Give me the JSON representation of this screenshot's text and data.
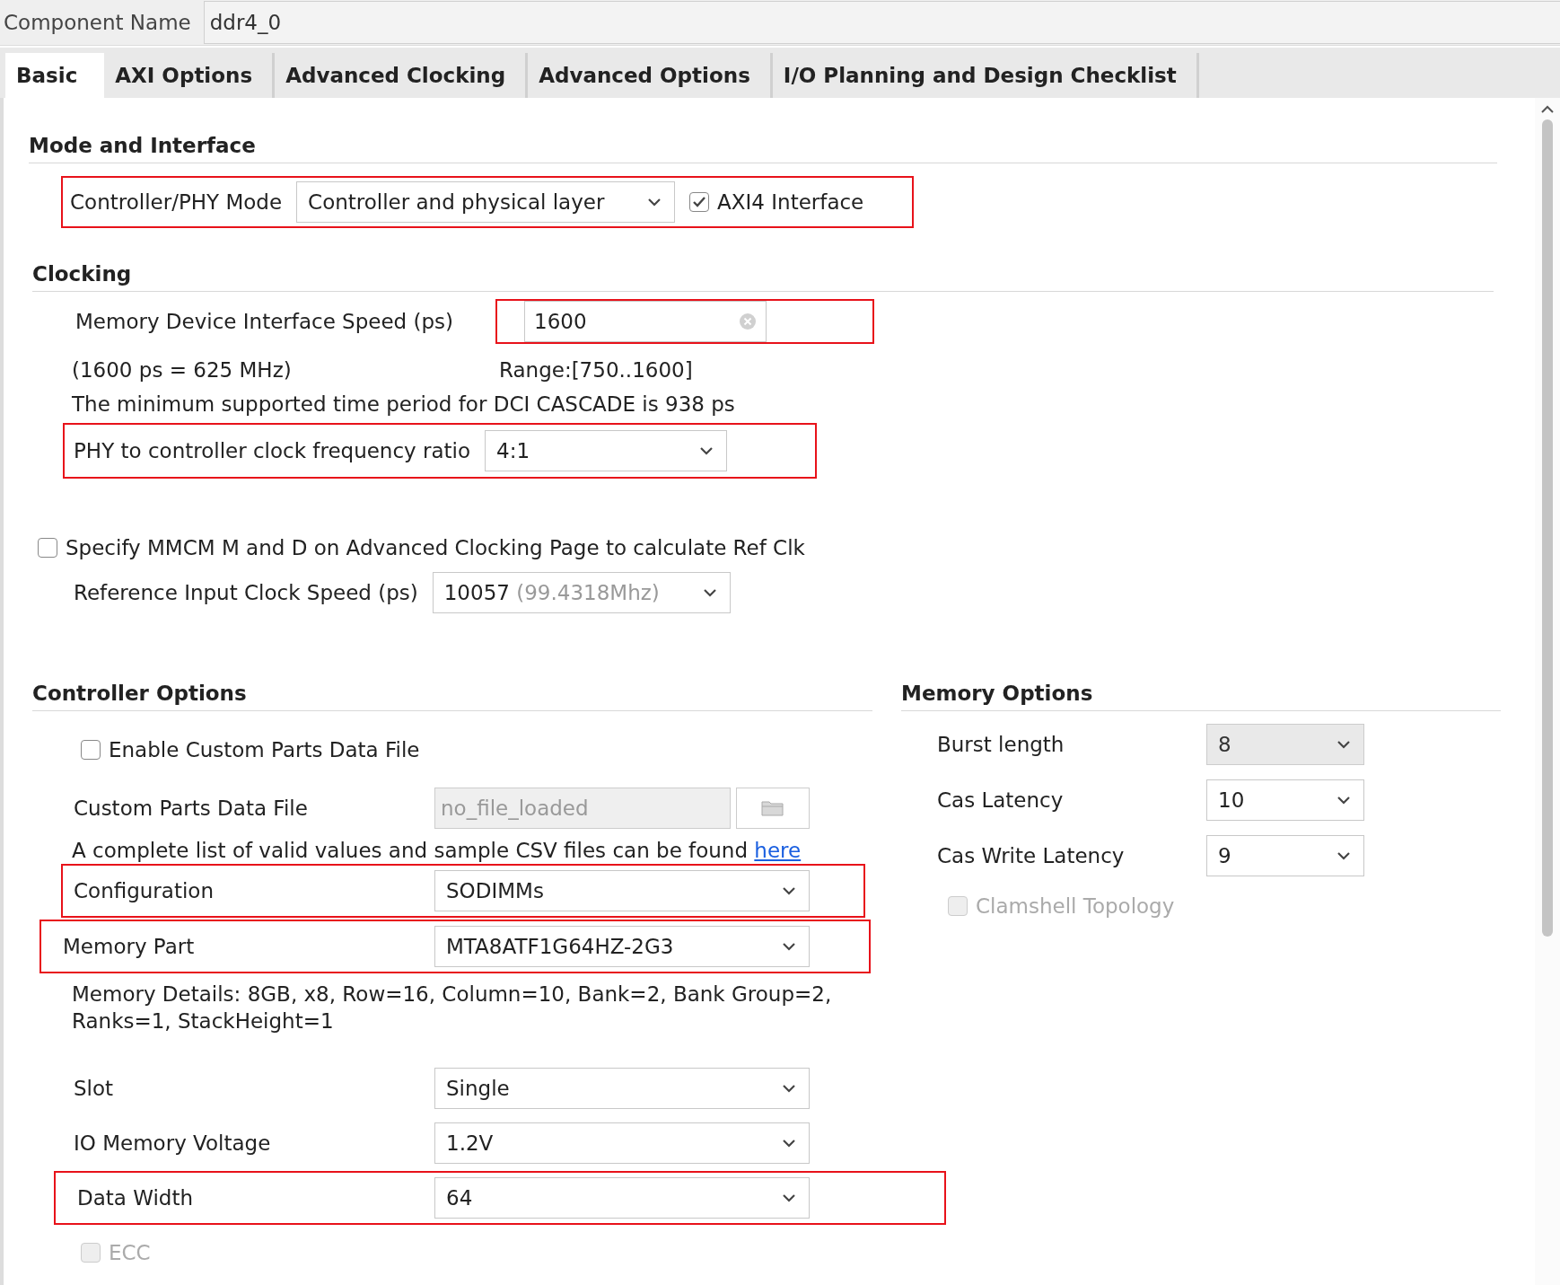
{
  "component_name": {
    "label": "Component Name",
    "value": "ddr4_0"
  },
  "tabs": [
    {
      "label": "Basic",
      "selected": true
    },
    {
      "label": "AXI Options",
      "selected": false
    },
    {
      "label": "Advanced Clocking",
      "selected": false
    },
    {
      "label": "Advanced Options",
      "selected": false
    },
    {
      "label": "I/O Planning and Design Checklist",
      "selected": false
    }
  ],
  "mode_and_interface": {
    "heading": "Mode and Interface",
    "highlighted": true,
    "controller_phy_mode": {
      "label": "Controller/PHY Mode",
      "value": "Controller and physical layer"
    },
    "axi4_interface": {
      "label": "AXI4 Interface",
      "checked": true
    }
  },
  "clocking": {
    "heading": "Clocking",
    "memory_device_interface_speed": {
      "label": "Memory Device Interface Speed (ps)",
      "value": "1600",
      "highlighted": true
    },
    "frequency_note": "(1600 ps = 625 MHz)",
    "range": "Range:[750..1600]",
    "note": "The minimum supported time period for DCI CASCADE is 938 ps",
    "phy_ratio": {
      "label": "PHY to controller clock frequency ratio",
      "value": "4:1",
      "highlighted": true
    },
    "specify_mmcm": {
      "label": "Specify MMCM M and D on Advanced Clocking Page to calculate Ref Clk",
      "checked": false
    },
    "reference_input_clock_speed": {
      "label": "Reference Input Clock Speed (ps)",
      "value": "10057",
      "hint": "(99.4318Mhz)"
    }
  },
  "controller_options": {
    "heading": "Controller Options",
    "enable_custom_parts": {
      "label": "Enable Custom Parts Data File",
      "checked": false
    },
    "custom_parts_data_file": {
      "label": "Custom Parts Data File",
      "value": "no_file_loaded",
      "disabled": true
    },
    "help_text": "A complete list of valid values and sample CSV files can be found",
    "help_link": "here",
    "fields": [
      {
        "label": "Configuration",
        "value": "SODIMMs",
        "highlighted": true
      },
      {
        "label": "Memory Part",
        "value": "MTA8ATF1G64HZ-2G3",
        "highlighted": true
      }
    ],
    "memory_details": "Memory Details: 8GB, x8, Row=16, Column=10, Bank=2, Bank Group=2, Ranks=1, StackHeight=1",
    "more_fields": [
      {
        "label": "Slot",
        "value": "Single",
        "highlighted": false
      },
      {
        "label": "IO Memory Voltage",
        "value": "1.2V",
        "highlighted": false
      },
      {
        "label": "Data Width",
        "value": "64",
        "highlighted": true
      }
    ],
    "ecc": {
      "label": "ECC",
      "checked": false,
      "disabled": true
    }
  },
  "memory_options": {
    "heading": "Memory Options",
    "fields": [
      {
        "label": "Burst length",
        "value": "8",
        "disabled": true
      },
      {
        "label": "Cas Latency",
        "value": "10",
        "disabled": false
      },
      {
        "label": "Cas Write Latency",
        "value": "9",
        "disabled": false
      }
    ],
    "clamshell_topology": {
      "label": "Clamshell Topology",
      "checked": false,
      "disabled": true
    }
  }
}
